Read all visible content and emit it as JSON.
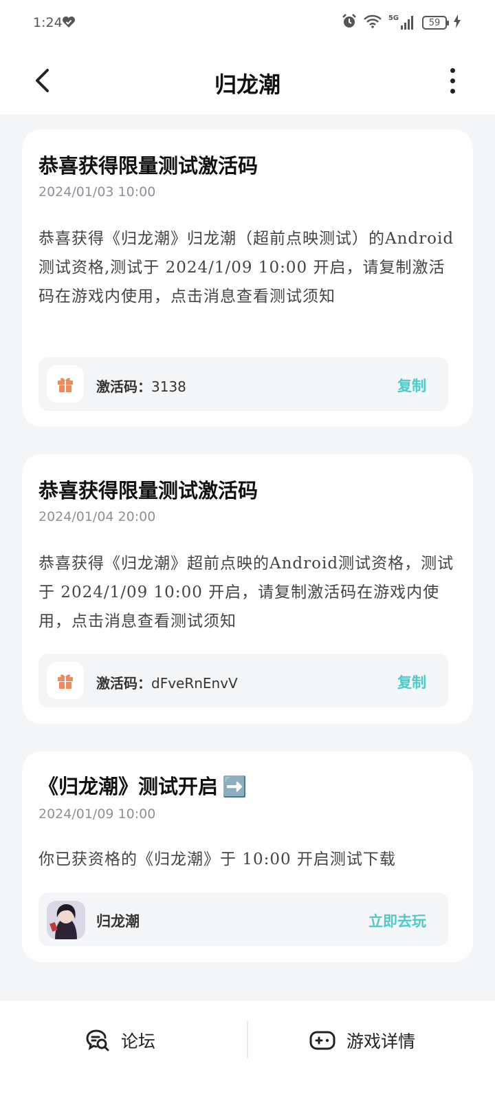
{
  "status_bar": {
    "time": "1:24",
    "network": "5G",
    "battery": "59"
  },
  "header": {
    "title": "归龙潮"
  },
  "messages": [
    {
      "title": "恭喜获得限量测试激活码",
      "date": "2024/01/03  10:00",
      "body": "恭喜获得《归龙潮》归龙潮（超前点映测试）的Android测试资格,测试于 2024/1/09 10:00 开启，请复制激活码在游戏内使用，点击消息查看测试须知",
      "code_label": "激活码：",
      "code": "3138",
      "action": "复制"
    },
    {
      "title": "恭喜获得限量测试激活码",
      "date": "2024/01/04  20:00",
      "body": "恭喜获得《归龙潮》超前点映的Android测试资格，测试于 2024/1/09 10:00 开启，请复制激活码在游戏内使用，点击消息查看测试须知",
      "code_label": "激活码：",
      "code": "dFveRnEnvV",
      "action": "复制"
    },
    {
      "title": "《归龙潮》测试开启",
      "title_emoji": "➡️",
      "date": "2024/01/09  10:00",
      "body": "你已获资格的《归龙潮》于 10:00 开启测试下载",
      "game_name": "归龙潮",
      "action": "立即去玩"
    }
  ],
  "bottom_nav": {
    "forum": "论坛",
    "game_details": "游戏详情"
  },
  "colors": {
    "accent": "#4FC9C9",
    "gift_icon": "#F08A5D",
    "background": "#F4F5F7"
  },
  "icons": [
    "heart-icon",
    "alarm-icon",
    "wifi-icon",
    "signal-icon",
    "battery-icon",
    "charging-icon",
    "back-icon",
    "more-icon",
    "gift-icon",
    "chat-search-icon",
    "gamepad-icon"
  ]
}
